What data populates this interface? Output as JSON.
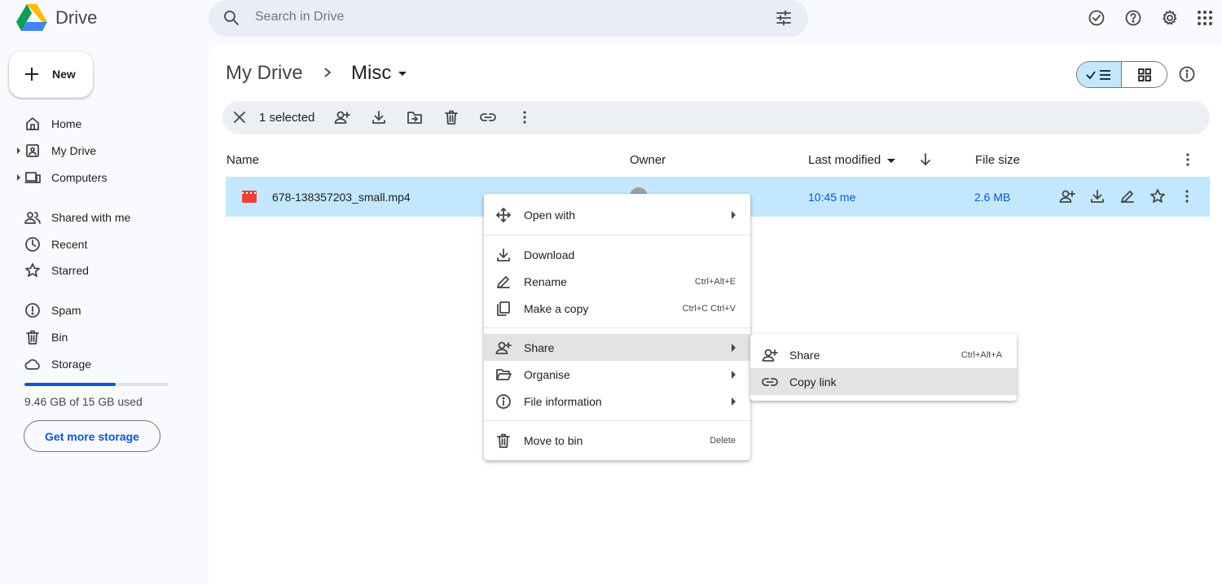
{
  "app": {
    "name": "Drive"
  },
  "search": {
    "placeholder": "Search in Drive"
  },
  "sidebar": {
    "new_label": "New",
    "items": [
      {
        "label": "Home"
      },
      {
        "label": "My Drive"
      },
      {
        "label": "Computers"
      },
      {
        "label": "Shared with me"
      },
      {
        "label": "Recent"
      },
      {
        "label": "Starred"
      },
      {
        "label": "Spam"
      },
      {
        "label": "Bin"
      },
      {
        "label": "Storage"
      }
    ],
    "storage_used_fraction": 0.63,
    "storage_text": "9.46 GB of 15 GB used",
    "get_storage_label": "Get more storage"
  },
  "breadcrumb": {
    "root": "My Drive",
    "current": "Misc"
  },
  "selection": {
    "count_label": "1 selected"
  },
  "table": {
    "headers": {
      "name": "Name",
      "owner": "Owner",
      "modified": "Last modified",
      "size": "File size"
    },
    "rows": [
      {
        "name": "678-138357203_small.mp4",
        "modified": "10:45 me",
        "size": "2.6 MB"
      }
    ]
  },
  "context_menu": {
    "items": [
      {
        "label": "Open with",
        "shortcut": ""
      },
      {
        "label": "Download",
        "shortcut": ""
      },
      {
        "label": "Rename",
        "shortcut": "Ctrl+Alt+E"
      },
      {
        "label": "Make a copy",
        "shortcut": "Ctrl+C Ctrl+V"
      },
      {
        "label": "Share",
        "shortcut": ""
      },
      {
        "label": "Organise",
        "shortcut": ""
      },
      {
        "label": "File information",
        "shortcut": ""
      },
      {
        "label": "Move to bin",
        "shortcut": "Delete"
      }
    ]
  },
  "share_submenu": {
    "items": [
      {
        "label": "Share",
        "shortcut": "Ctrl+Alt+A"
      },
      {
        "label": "Copy link",
        "shortcut": ""
      }
    ]
  },
  "colors": {
    "accent": "#0b57d0",
    "selected_row": "#c2e7ff",
    "background": "#f8fafd"
  }
}
